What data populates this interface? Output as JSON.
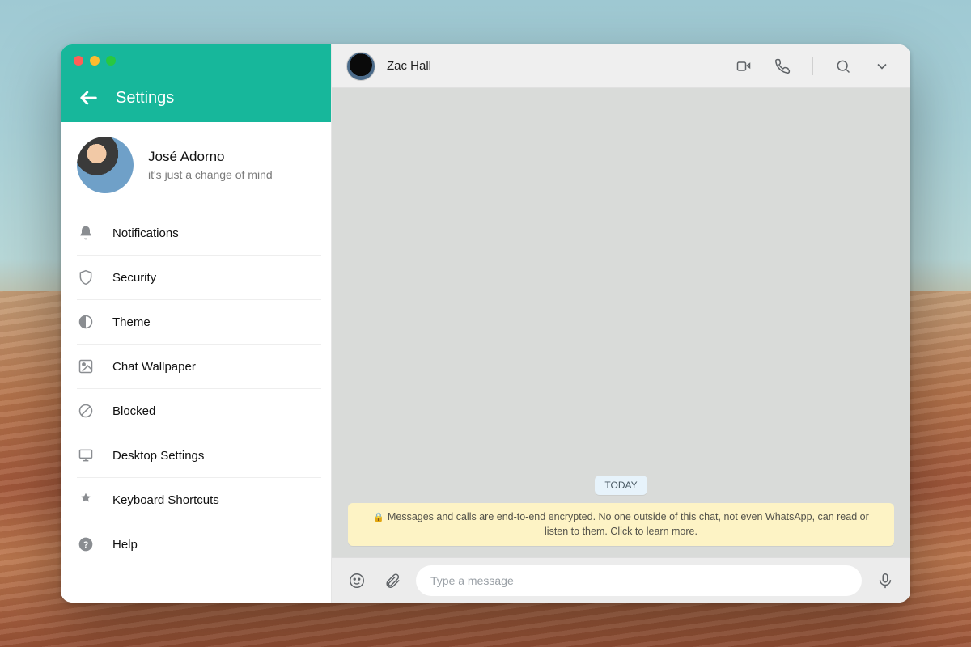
{
  "colors": {
    "brand": "#17b79b"
  },
  "sidebar": {
    "title": "Settings",
    "profile": {
      "name": "José Adorno",
      "status": "it's just a change of mind"
    },
    "items": [
      {
        "icon": "bell",
        "label": "Notifications"
      },
      {
        "icon": "shield",
        "label": "Security"
      },
      {
        "icon": "theme",
        "label": "Theme"
      },
      {
        "icon": "wallpaper",
        "label": "Chat Wallpaper"
      },
      {
        "icon": "blocked",
        "label": "Blocked"
      },
      {
        "icon": "desktop",
        "label": "Desktop Settings"
      },
      {
        "icon": "keyboard",
        "label": "Keyboard Shortcuts"
      },
      {
        "icon": "help",
        "label": "Help"
      }
    ]
  },
  "chat": {
    "contact_name": "Zac Hall",
    "date_chip": "TODAY",
    "encryption_notice": "Messages and calls are end-to-end encrypted. No one outside of this chat, not even WhatsApp, can read or listen to them. Click to learn more.",
    "input_placeholder": "Type a message"
  }
}
